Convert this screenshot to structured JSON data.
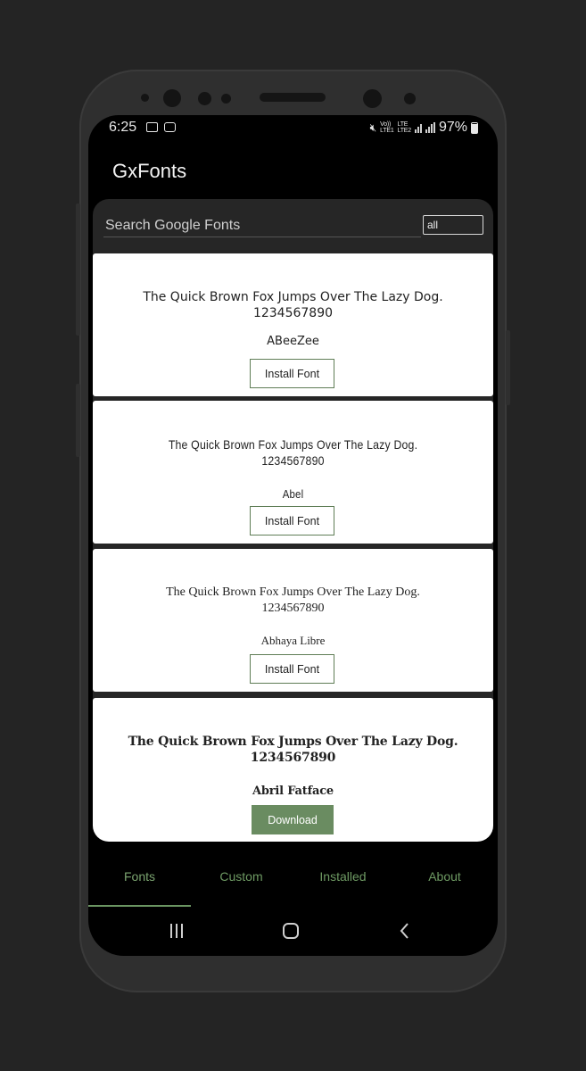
{
  "status_bar": {
    "time": "6:25",
    "vol_label": "Vo))",
    "lte1_label": "LTE1",
    "lte_label": "LTE",
    "lte2_label": "LTE2",
    "battery_percent": "97%"
  },
  "app": {
    "title": "GxFonts"
  },
  "search": {
    "placeholder": "Search Google Fonts",
    "filter_value": "all"
  },
  "fonts": [
    {
      "sample_line1": "The Quick Brown Fox Jumps Over The Lazy Dog.",
      "sample_line2": "1234567890",
      "name": "ABeeZee",
      "button": "Install Font"
    },
    {
      "sample_line1": "The Quick Brown Fox Jumps Over The Lazy Dog.",
      "sample_line2": "1234567890",
      "name": "Abel",
      "button": "Install Font"
    },
    {
      "sample_line1": "The Quick Brown Fox Jumps Over The Lazy Dog.",
      "sample_line2": "1234567890",
      "name": "Abhaya Libre",
      "button": "Install Font"
    },
    {
      "sample_line1": "The Quick Brown Fox Jumps Over The Lazy Dog.",
      "sample_line2": "1234567890",
      "name": "Abril Fatface",
      "button": "Download"
    }
  ],
  "tabs": [
    {
      "label": "Fonts",
      "active": true
    },
    {
      "label": "Custom"
    },
    {
      "label": "Installed"
    },
    {
      "label": "About"
    }
  ],
  "colors": {
    "accent": "#6a8c61",
    "tab_text": "#6e9a63",
    "background": "#000000",
    "card": "#ffffff"
  },
  "nav": {
    "recents_icon": "recents-icon",
    "home_icon": "home-icon",
    "back_icon": "back-icon"
  }
}
